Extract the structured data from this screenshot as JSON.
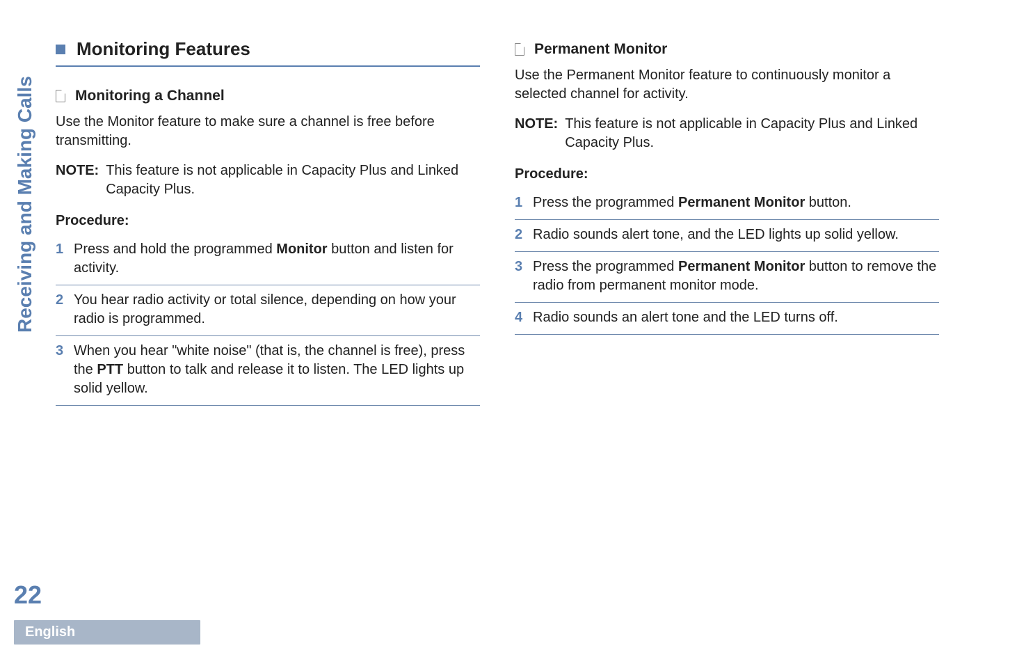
{
  "sidebar": {
    "section_label": "Receiving and Making Calls",
    "page_number": "22",
    "language": "English"
  },
  "left_column": {
    "main_heading": "Monitoring Features",
    "sub_heading": "Monitoring a Channel",
    "intro": "Use the Monitor feature to make sure a channel is free before transmitting.",
    "note_label": "NOTE:",
    "note_text": "This feature is not applicable in Capacity Plus and Linked Capacity Plus.",
    "procedure_label": "Procedure:",
    "steps": [
      {
        "num": "1",
        "pre": "Press and hold the programmed ",
        "bold": "Monitor",
        "post": " button and listen for activity."
      },
      {
        "num": "2",
        "pre": "You hear radio activity or total silence, depending on how your radio is programmed.",
        "bold": "",
        "post": ""
      },
      {
        "num": "3",
        "pre": "When you hear \"white noise\" (that is, the channel is free), press the ",
        "bold": "PTT",
        "post": " button to talk and release it to listen. The LED lights up solid yellow."
      }
    ]
  },
  "right_column": {
    "sub_heading": "Permanent Monitor",
    "intro": "Use the Permanent Monitor feature to continuously monitor a selected channel for activity.",
    "note_label": "NOTE:",
    "note_text": "This feature is not applicable in Capacity Plus and Linked Capacity Plus.",
    "procedure_label": "Procedure:",
    "steps": [
      {
        "num": "1",
        "pre": "Press the programmed ",
        "bold": "Permanent Monitor",
        "post": " button."
      },
      {
        "num": "2",
        "pre": "Radio sounds alert tone, and the LED lights up solid yellow.",
        "bold": "",
        "post": ""
      },
      {
        "num": "3",
        "pre": "Press the programmed ",
        "bold": "Permanent Monitor",
        "post": " button to remove the radio from permanent monitor mode."
      },
      {
        "num": "4",
        "pre": "Radio sounds an alert tone and the LED turns off.",
        "bold": "",
        "post": ""
      }
    ]
  }
}
